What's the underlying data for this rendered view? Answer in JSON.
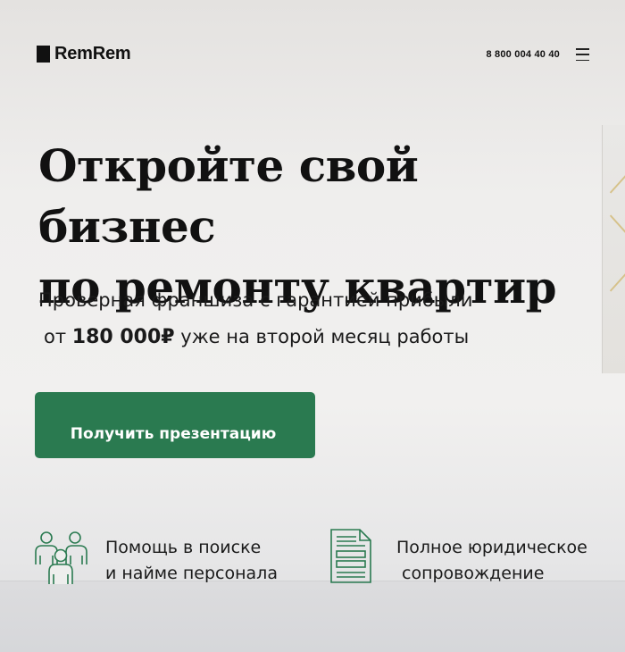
{
  "header": {
    "logo_text": "RemRem",
    "phone": "8 800 004 40 40",
    "menu_icon": "hamburger-menu-icon"
  },
  "hero": {
    "title_line1": "Откройте свой бизнес",
    "title_line2": "по ремонту квартир",
    "subtitle_line1": "Проверная франшиза с гарантией прибыли",
    "subtitle_prefix": "от",
    "subtitle_amount": "180 000₽",
    "subtitle_suffix": "уже на второй месяц работы",
    "cta_label": "Получить презентацию"
  },
  "features": [
    {
      "icon": "team-people-icon",
      "line1": "Помощь в поиске",
      "line2": "и найме персонала"
    },
    {
      "icon": "document-icon",
      "line1": "Полное юридическое",
      "line2": "сопровождение"
    }
  ],
  "colors": {
    "accent": "#2a7a50",
    "text": "#111111"
  }
}
